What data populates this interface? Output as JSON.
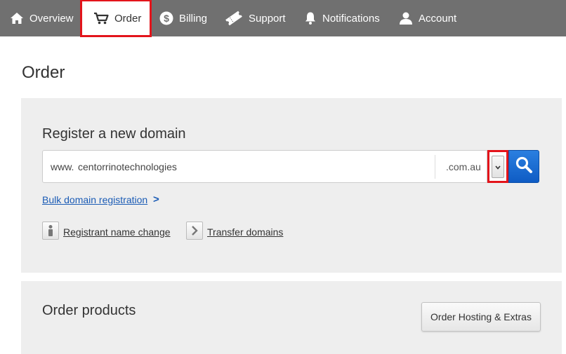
{
  "nav": {
    "items": [
      {
        "label": "Overview",
        "icon": "home-icon"
      },
      {
        "label": "Order",
        "icon": "cart-icon",
        "active": true
      },
      {
        "label": "Billing",
        "icon": "dollar-icon"
      },
      {
        "label": "Support",
        "icon": "ticket-icon"
      },
      {
        "label": "Notifications",
        "icon": "bell-icon"
      },
      {
        "label": "Account",
        "icon": "user-icon"
      }
    ]
  },
  "page": {
    "title": "Order"
  },
  "register": {
    "heading": "Register a new domain",
    "prefix": "www.",
    "domain_value": "centorrinotechnologies",
    "tld_value": ".com.au",
    "bulk_link": "Bulk domain registration",
    "bulk_chevron": ">",
    "registrant_link": "Registrant name change",
    "transfer_link": "Transfer domains"
  },
  "products": {
    "heading": "Order products",
    "order_hosting_label": "Order Hosting & Extras"
  },
  "colors": {
    "nav_bg": "#707070",
    "highlight": "#e3141b",
    "panel_bg": "#eeeeee",
    "link_blue": "#1a5bb5",
    "search_blue": "#1565d0"
  }
}
